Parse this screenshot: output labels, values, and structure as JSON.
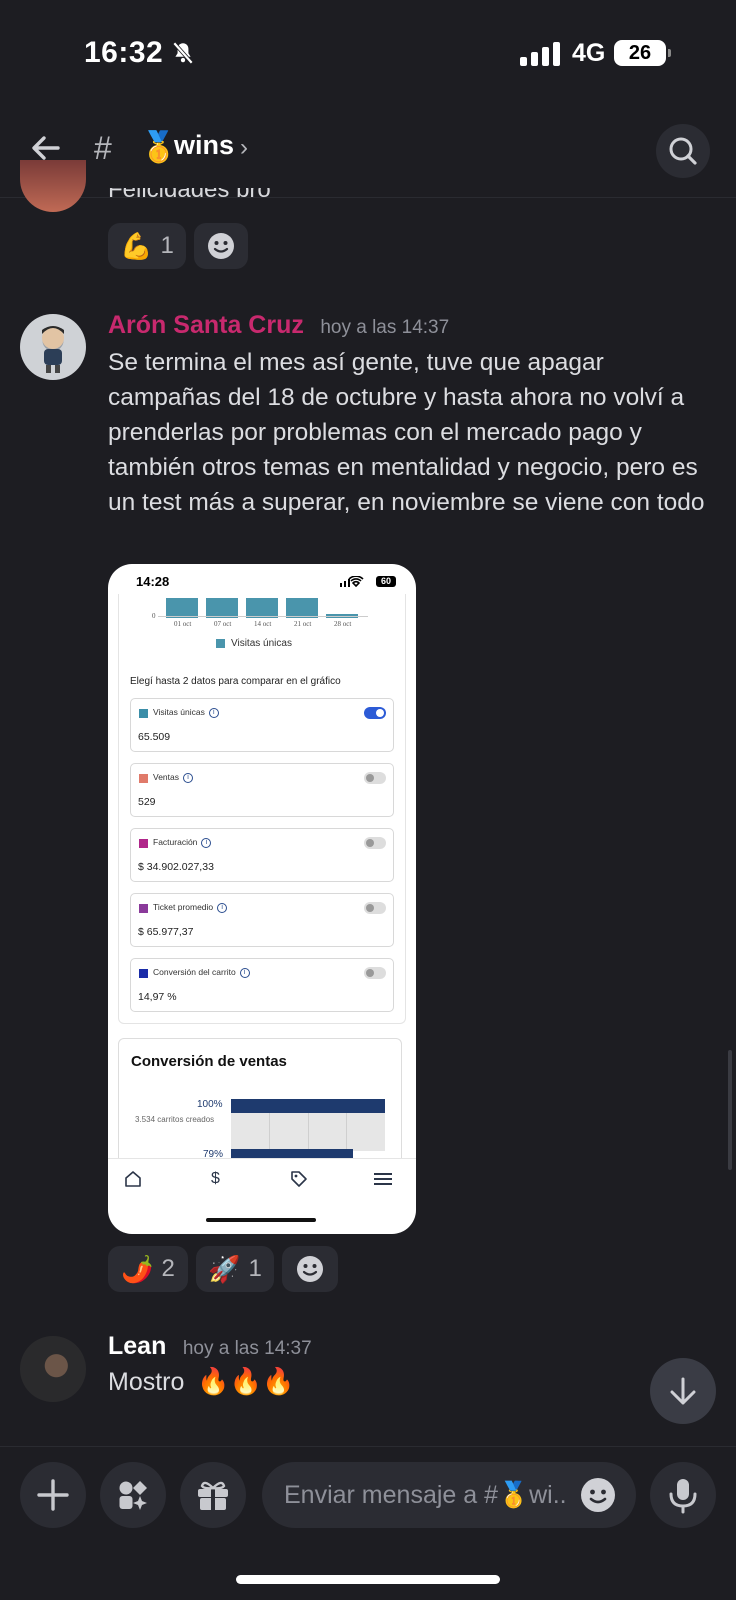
{
  "status_bar": {
    "time": "16:32",
    "network": "4G",
    "battery": "26"
  },
  "header": {
    "hash": "#",
    "channel_emoji": "🥇",
    "channel_name": "wins",
    "chevron": "›"
  },
  "previous_message": {
    "text_tail": "Felicidades bro",
    "reactions": [
      {
        "emoji": "💪",
        "count": "1"
      }
    ]
  },
  "messages": [
    {
      "author": "Arón Santa Cruz",
      "author_color": "#c8296e",
      "time": "hoy a las 14:37",
      "text": "Se termina el mes así gente, tuve que apagar campañas del 18 de octubre y hasta ahora no volví a prenderlas por problemas con el mercado pago y también otros temas en mentalidad y negocio, pero es un test más a superar, en noviembre se viene con todo",
      "attachment": {
        "time": "14:28",
        "battery": "60",
        "chart_ticks": [
          "0",
          "01 oct",
          "07 oct",
          "14 oct",
          "21 oct",
          "28 oct"
        ],
        "legend": "Visitas únicas",
        "instruction": "Elegí hasta 2 datos para comparar en el gráfico",
        "metrics": [
          {
            "label": "Visitas únicas",
            "value": "65.509",
            "color": "#3b8ea8",
            "enabled": true
          },
          {
            "label": "Ventas",
            "value": "529",
            "color": "#e07a6a",
            "enabled": false
          },
          {
            "label": "Facturación",
            "value": "$ 34.902.027,33",
            "color": "#b0268a",
            "enabled": false
          },
          {
            "label": "Ticket promedio",
            "value": "$ 65.977,37",
            "color": "#8a3a9a",
            "enabled": false
          },
          {
            "label": "Conversión del carrito",
            "value": "14,97 %",
            "color": "#1a2ca8",
            "enabled": false
          }
        ],
        "conversion": {
          "title": "Conversión de ventas",
          "first_pct": "100%",
          "first_sub": "3.534 carritos creados",
          "second_pct": "79%"
        }
      },
      "reactions": [
        {
          "emoji": "🌶️",
          "count": "2"
        },
        {
          "emoji": "🚀",
          "count": "1"
        }
      ]
    },
    {
      "author": "Lean",
      "author_color": "#ffffff",
      "time": "hoy a las 14:37",
      "text": "Mostro",
      "text_emojis": "🔥🔥🔥"
    }
  ],
  "composer": {
    "placeholder": "Enviar mensaje a #🥇wi.."
  }
}
